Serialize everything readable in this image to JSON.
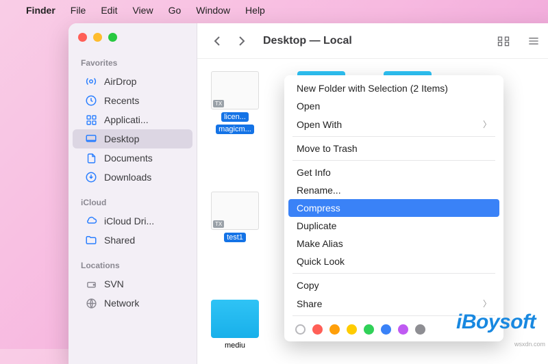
{
  "menubar": {
    "app": "Finder",
    "items": [
      "File",
      "Edit",
      "View",
      "Go",
      "Window",
      "Help"
    ]
  },
  "sidebar": {
    "sections": [
      {
        "title": "Favorites",
        "items": [
          {
            "icon": "airdrop",
            "label": "AirDrop"
          },
          {
            "icon": "clock",
            "label": "Recents"
          },
          {
            "icon": "apps",
            "label": "Applicati..."
          },
          {
            "icon": "desktop",
            "label": "Desktop",
            "selected": true
          },
          {
            "icon": "doc",
            "label": "Documents"
          },
          {
            "icon": "download",
            "label": "Downloads"
          }
        ]
      },
      {
        "title": "iCloud",
        "items": [
          {
            "icon": "cloud",
            "label": "iCloud Dri..."
          },
          {
            "icon": "shared",
            "label": "Shared"
          }
        ]
      },
      {
        "title": "Locations",
        "items": [
          {
            "icon": "disk",
            "label": "SVN",
            "grey": true
          },
          {
            "icon": "globe",
            "label": "Network",
            "grey": true
          }
        ]
      }
    ]
  },
  "toolbar": {
    "title": "Desktop — Local"
  },
  "files": {
    "row1": [
      {
        "kind": "txt",
        "name": "licen...",
        "name2": "magicm...",
        "sel": true
      },
      {
        "kind": "folder",
        "name": ""
      },
      {
        "kind": "folder",
        "name": ""
      }
    ],
    "row2": [
      {
        "kind": "txt",
        "name": "test1",
        "sel": true
      }
    ],
    "row3": [
      {
        "kind": "folder",
        "name": "mediu"
      }
    ]
  },
  "context_menu": {
    "groups": [
      [
        "New Folder with Selection (2 Items)",
        "Open",
        "Open With"
      ],
      [
        "Move to Trash"
      ],
      [
        "Get Info",
        "Rename...",
        "Compress",
        "Duplicate",
        "Make Alias",
        "Quick Look"
      ],
      [
        "Copy",
        "Share"
      ]
    ],
    "submenu_items": [
      "Open With",
      "Share"
    ],
    "highlighted": "Compress",
    "tag_colors": [
      "#ff5f57",
      "#ff9f0a",
      "#ffcc00",
      "#30d158",
      "#3a82f7",
      "#bf5af2",
      "#8e8e93"
    ]
  },
  "brand": "iBoysoft",
  "attribution": "wsxdn.com"
}
